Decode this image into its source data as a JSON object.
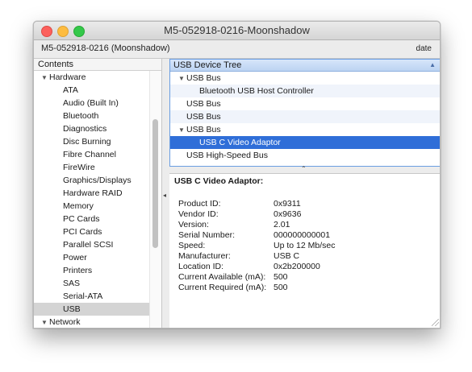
{
  "window": {
    "title": "M5-052918-0216-Moonshadow"
  },
  "infobar": {
    "machine": "M5-052918-0216 (Moonshadow)",
    "date_label": "date"
  },
  "sidebar": {
    "header": "Contents",
    "items": [
      {
        "label": "Hardware",
        "group": true
      },
      {
        "label": "ATA"
      },
      {
        "label": "Audio (Built In)"
      },
      {
        "label": "Bluetooth"
      },
      {
        "label": "Diagnostics"
      },
      {
        "label": "Disc Burning"
      },
      {
        "label": "Fibre Channel"
      },
      {
        "label": "FireWire"
      },
      {
        "label": "Graphics/Displays"
      },
      {
        "label": "Hardware RAID"
      },
      {
        "label": "Memory"
      },
      {
        "label": "PC Cards"
      },
      {
        "label": "PCI Cards"
      },
      {
        "label": "Parallel SCSI"
      },
      {
        "label": "Power"
      },
      {
        "label": "Printers"
      },
      {
        "label": "SAS"
      },
      {
        "label": "Serial-ATA"
      },
      {
        "label": "USB",
        "selected": true
      },
      {
        "label": "Network",
        "group": true
      }
    ]
  },
  "device_tree": {
    "header": "USB Device Tree",
    "rows": [
      {
        "label": "USB Bus"
      },
      {
        "label": "Bluetooth USB Host Controller"
      },
      {
        "label": "USB Bus"
      },
      {
        "label": "USB Bus"
      },
      {
        "label": "USB Bus"
      },
      {
        "label": "USB C Video Adaptor"
      },
      {
        "label": "USB High-Speed Bus"
      }
    ]
  },
  "details": {
    "title": "USB C Video Adaptor:",
    "fields": [
      {
        "key": "Product ID:",
        "value": "0x9311"
      },
      {
        "key": "Vendor ID:",
        "value": "0x9636"
      },
      {
        "key": "Version:",
        "value": "2.01"
      },
      {
        "key": "Serial Number:",
        "value": "000000000001"
      },
      {
        "key": "Speed:",
        "value": "Up to 12 Mb/sec"
      },
      {
        "key": "Manufacturer:",
        "value": "USB C"
      },
      {
        "key": "Location ID:",
        "value": "0x2b200000"
      },
      {
        "key": "Current Available (mA):",
        "value": "500"
      },
      {
        "key": "Current Required (mA):",
        "value": "500"
      }
    ]
  },
  "colors": {
    "selection": "#2f6ed8",
    "sidebar_selection": "#d4d4d4",
    "close": "#fc605c",
    "minimize": "#fdbc40",
    "maximize": "#34c84a"
  }
}
